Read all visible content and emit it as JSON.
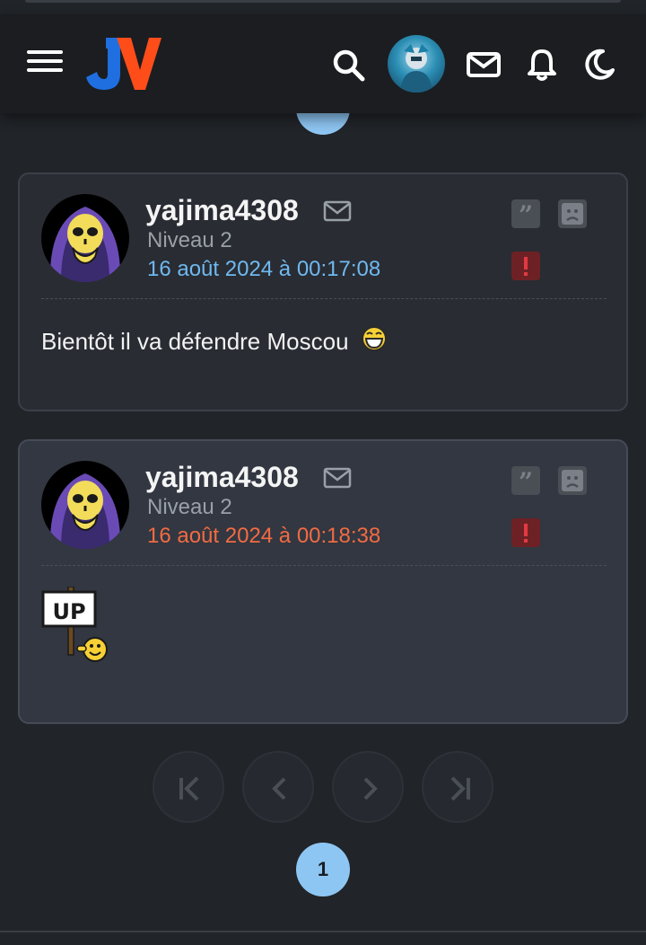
{
  "header": {
    "logo": "JV",
    "icons": [
      "menu-icon",
      "search-icon",
      "user-avatar",
      "mail-icon",
      "bell-icon",
      "moon-icon"
    ]
  },
  "posts": [
    {
      "username": "yajima4308",
      "level": "Niveau 2",
      "date": "16 août 2024 à 00:17:08",
      "message": "Bientôt il va défendre Moscou",
      "emoji": "laughing-emoji"
    },
    {
      "username": "yajima4308",
      "level": "Niveau 2",
      "date": "16 août 2024 à 00:18:38",
      "message": "",
      "sticker": "up-sign-sticker",
      "sticker_text": "UP"
    }
  ],
  "pagination": {
    "current_page": "1",
    "buttons": [
      "first-page",
      "previous-page",
      "next-page",
      "last-page"
    ]
  },
  "colors": {
    "background": "#212429",
    "header": "#1b1d21",
    "accent_blue": "#8ec6f3",
    "date_blue": "#6fb9f0",
    "date_orange": "#f26b42",
    "report_red": "#6e2125"
  }
}
